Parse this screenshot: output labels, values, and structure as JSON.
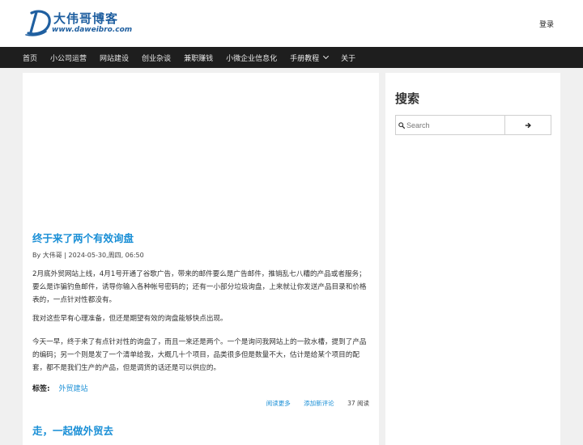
{
  "header": {
    "logo_cn": "大伟哥博客",
    "logo_url": "www.daweibro.com",
    "login_label": "登录"
  },
  "nav": {
    "items": [
      "首页",
      "小公司运营",
      "网站建设",
      "创业杂谈",
      "兼职赚钱",
      "小微企业信息化",
      "手册教程",
      "关于"
    ]
  },
  "posts": [
    {
      "title": "终于来了两个有效询盘",
      "meta": "By 大伟哥 | 2024-05-30,周四, 06:50",
      "paragraphs": [
        "2月底外贸网站上线，4月1号开通了谷歌广告，带来的邮件要么是广告邮件，推销乱七八糟的产品或者服务；要么是诈骗钓鱼邮件，诱导你输入各种帐号密码的；还有一小部分垃圾询盘，上来就让你发送产品目录和价格表的，一点针对性都没有。",
        "我对这些早有心理准备，但还是期望有效的询盘能够快点出现。",
        "今天一早，终于来了有点针对性的询盘了，而且一来还是两个。一个是询问我网站上的一款水槽，提到了产品的编码；另一个则是发了一个清单给我，大概几十个项目，品类很多但是数量不大，估计是给某个项目的配套，都不是我们生产的产品，但是调货的话还是可以供应的。"
      ],
      "tags_label": "标签:",
      "tag": "外贸建站",
      "read_more": "阅读更多",
      "add_comment": "添加新评论",
      "reads": "37 阅读"
    },
    {
      "title": "走，一起做外贸去"
    }
  ],
  "sidebar": {
    "search_title": "搜索",
    "search_placeholder": "Search"
  },
  "colors": {
    "accent": "#1a8fd6",
    "navbar_bg": "#1e1e1e",
    "logo": "#1f5fa0",
    "page_bg": "#f0f0f0"
  },
  "icons": [
    "logo-d-icon",
    "chevron-down-icon",
    "search-icon",
    "arrow-right-icon"
  ]
}
